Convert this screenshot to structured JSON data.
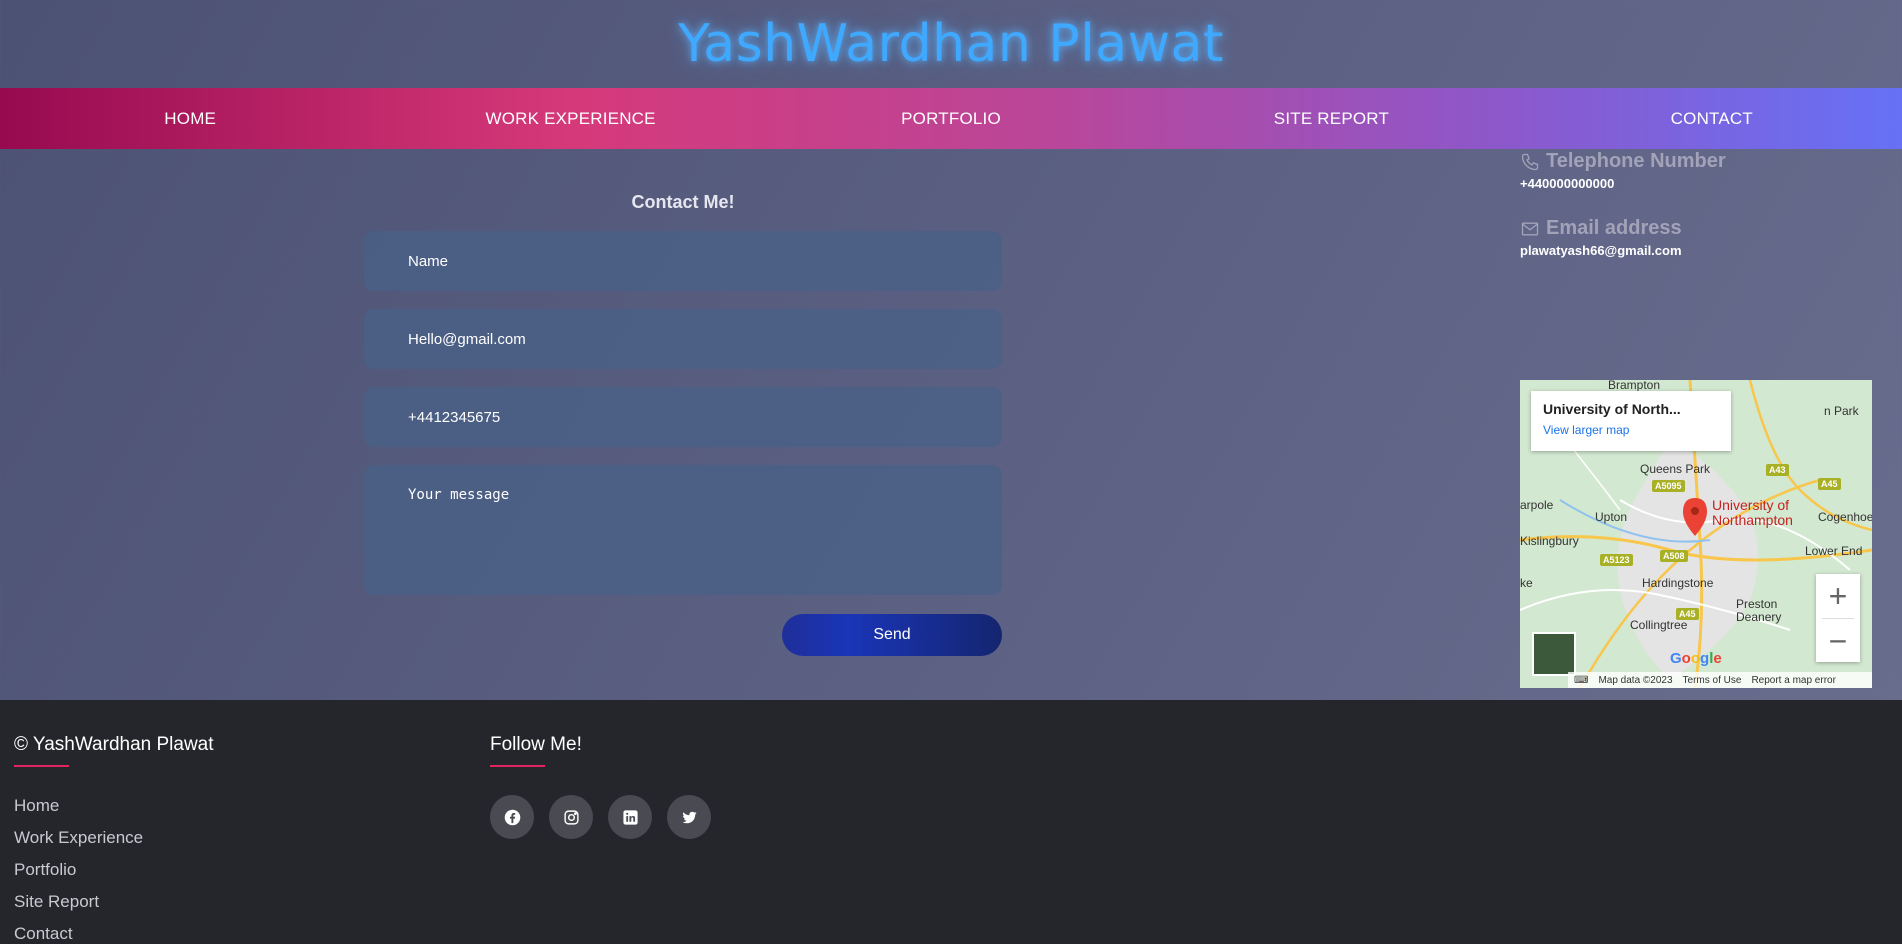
{
  "header": {
    "title": "YashWardhan Plawat"
  },
  "nav": {
    "items": [
      "HOME",
      "WORK EXPERIENCE",
      "PORTFOLIO",
      "SITE REPORT",
      "CONTACT"
    ]
  },
  "contact_form": {
    "heading": "Contact Me!",
    "name_placeholder": "Name",
    "email_placeholder": "Hello@gmail.com",
    "phone_placeholder": "+4412345675",
    "message_placeholder": "Your message",
    "send_label": "Send"
  },
  "contact_info": {
    "phone_label": "Telephone Number",
    "phone_value": "+440000000000",
    "email_label": "Email address",
    "email_value": "plawatyash66@gmail.com"
  },
  "map": {
    "card_title": "University of North...",
    "card_link": "View larger map",
    "places": [
      "Brampton",
      "Queens Park",
      "Upton",
      "Kislingbury",
      "Hardingstone",
      "Preston Deanery",
      "Collingtree",
      "Lower End",
      "Cogenhoe",
      "arpole",
      "ke",
      "n Park"
    ],
    "marker_label_1": "University of",
    "marker_label_2": "Northampton",
    "roads": [
      "A5095",
      "A43",
      "A45",
      "A508",
      "A5123",
      "A45"
    ],
    "zoom_in": "+",
    "zoom_out": "−",
    "google": "Google",
    "footer_items": [
      "Map data ©2023",
      "Terms of Use",
      "Report a map error"
    ]
  },
  "footer": {
    "copyright": "© YashWardhan Plawat",
    "links": [
      "Home",
      "Work Experience",
      "Portfolio",
      "Site Report",
      "Contact"
    ],
    "follow_title": "Follow Me!",
    "socials": [
      "facebook-icon",
      "instagram-icon",
      "linkedin-icon",
      "twitter-icon"
    ]
  },
  "colors": {
    "title_glow": "#3fa9ff",
    "nav_gradient_start": "#970a4f",
    "nav_gradient_end": "#6671f6",
    "footer_accent": "#e0245e",
    "footer_bg": "#25262c"
  }
}
